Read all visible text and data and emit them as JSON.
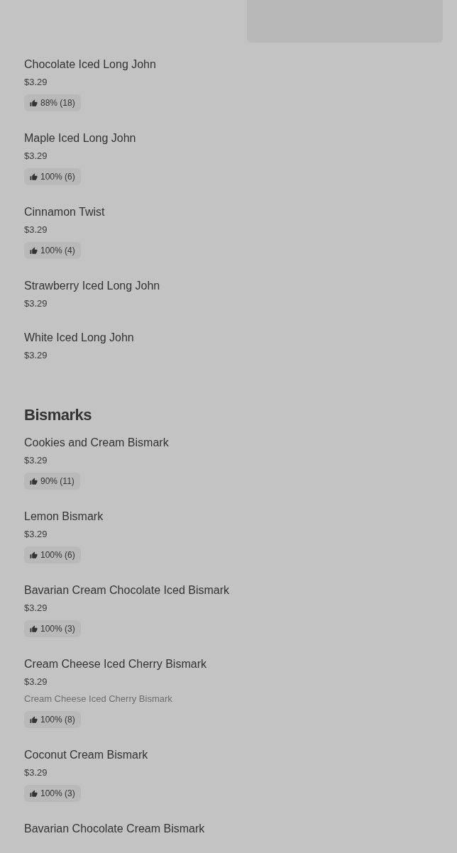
{
  "sections": [
    {
      "items": [
        {
          "name": "Chocolate Iced Long John",
          "price": "$3.29",
          "rating": "88% (18)"
        },
        {
          "name": "Maple Iced Long John",
          "price": "$3.29",
          "rating": "100% (6)"
        },
        {
          "name": "Cinnamon Twist",
          "price": "$3.29",
          "rating": "100% (4)"
        },
        {
          "name": "Strawberry Iced Long John",
          "price": "$3.29"
        },
        {
          "name": "White Iced Long John",
          "price": "$3.29"
        }
      ]
    },
    {
      "title": "Bismarks",
      "items": [
        {
          "name": "Cookies and Cream Bismark",
          "price": "$3.29",
          "rating": "90% (11)"
        },
        {
          "name": "Lemon Bismark",
          "price": "$3.29",
          "rating": "100% (6)"
        },
        {
          "name": "Bavarian Cream Chocolate Iced Bismark",
          "price": "$3.29",
          "rating": "100% (3)"
        },
        {
          "name": "Cream Cheese Iced Cherry Bismark",
          "price": "$3.29",
          "description": "Cream Cheese Iced Cherry Bismark",
          "rating": "100% (8)"
        },
        {
          "name": "Coconut Cream Bismark",
          "price": "$3.29",
          "rating": "100% (3)"
        },
        {
          "name": "Bavarian Chocolate Cream Bismark"
        }
      ]
    }
  ]
}
